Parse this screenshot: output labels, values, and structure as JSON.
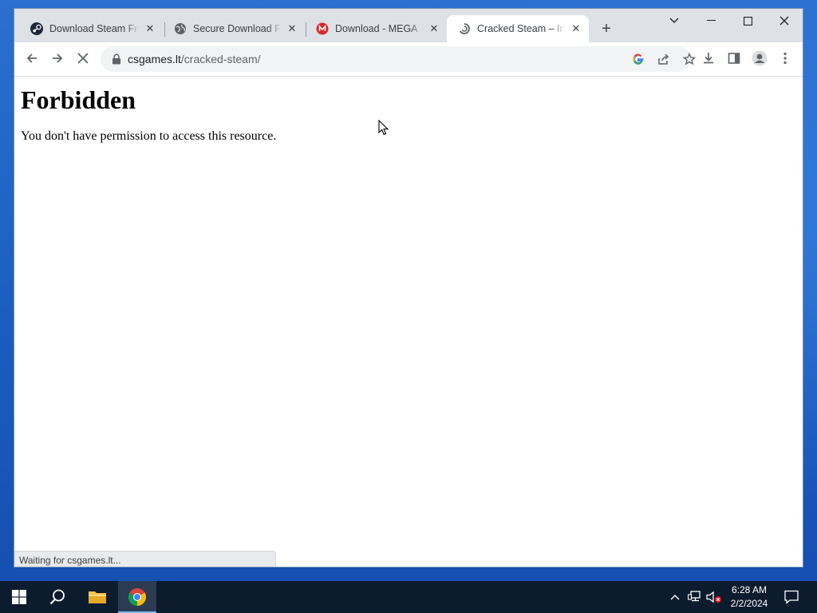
{
  "browser": {
    "tabs": [
      {
        "title": "Download Steam Free",
        "favicon": "steam-icon",
        "active": false
      },
      {
        "title": "Secure Download File",
        "favicon": "globe-icon",
        "active": false
      },
      {
        "title": "Download - MEGA",
        "favicon": "mega-icon",
        "active": false
      },
      {
        "title": "Cracked Steam – Install",
        "favicon": "loading-icon",
        "active": true
      }
    ],
    "address": {
      "host": "csgames.lt",
      "path": "/cracked-steam/"
    },
    "status": "Waiting for csgames.lt..."
  },
  "page": {
    "heading": "Forbidden",
    "message": "You don't have permission to access this resource."
  },
  "taskbar": {
    "clock_time": "6:28 AM",
    "clock_date": "2/2/2024"
  },
  "colors": {
    "accent": "#76b9ed",
    "tabstrip": "#dee1e6",
    "mega_red": "#d9272e",
    "taskbar": "#0d1b2e"
  }
}
